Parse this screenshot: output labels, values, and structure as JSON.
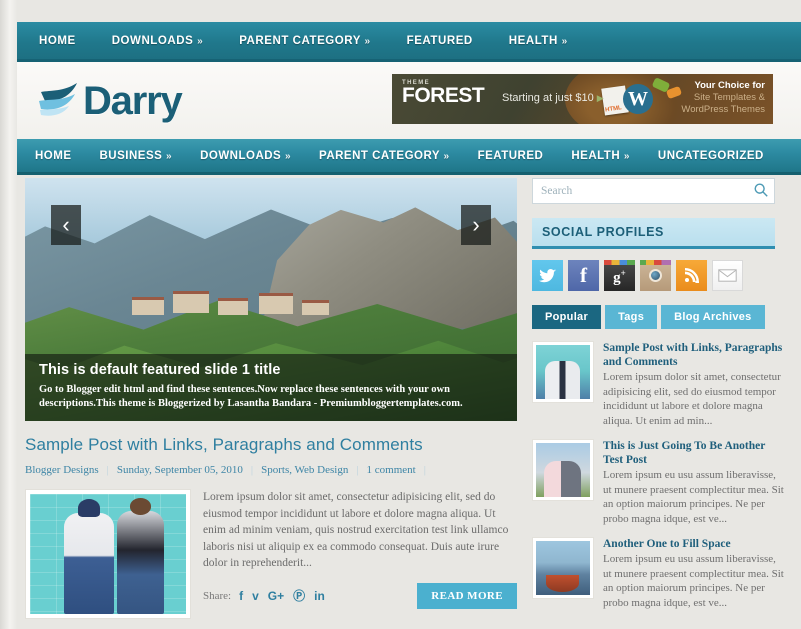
{
  "topnav": {
    "items": [
      {
        "label": "HOME",
        "caret": false
      },
      {
        "label": "DOWNLOADS",
        "caret": true
      },
      {
        "label": "PARENT CATEGORY",
        "caret": true
      },
      {
        "label": "FEATURED",
        "caret": false
      },
      {
        "label": "HEALTH",
        "caret": true
      }
    ]
  },
  "header": {
    "logo_text": "Darry",
    "logo_icon": "wing-swoosh-icon"
  },
  "ad": {
    "brand_small": "THEME",
    "brand_big": "FOREST",
    "price_text": "Starting at just $10",
    "arrow": "▶",
    "line1": "Your Choice for",
    "line2": "Site Templates &",
    "line3": "WordPress Themes",
    "wp_letter": "W",
    "doc_label": "HTML"
  },
  "mainnav": {
    "items": [
      {
        "label": "HOME",
        "caret": false
      },
      {
        "label": "BUSINESS",
        "caret": true
      },
      {
        "label": "DOWNLOADS",
        "caret": true
      },
      {
        "label": "PARENT CATEGORY",
        "caret": true
      },
      {
        "label": "FEATURED",
        "caret": false
      },
      {
        "label": "HEALTH",
        "caret": true
      },
      {
        "label": "UNCATEGORIZED",
        "caret": false
      }
    ]
  },
  "slider": {
    "prev_glyph": "‹",
    "next_glyph": "›",
    "title": "This is default featured slide 1 title",
    "description": "Go to Blogger edit html and find these sentences.Now replace these sentences with your own descriptions.This theme is Bloggerized by Lasantha Bandara - Premiumbloggertemplates.com."
  },
  "post": {
    "title": "Sample Post with Links, Paragraphs and Comments",
    "author": "Blogger Designs",
    "date": "Sunday, September 05, 2010",
    "categories": "Sports, Web Design",
    "comments": "1 comment",
    "excerpt": "Lorem ipsum dolor sit amet, consectetur adipisicing elit, sed do eiusmod tempor incididunt ut labore et dolore magna aliqua. Ut enim ad minim veniam, quis nostrud exercitation test link ullamco laboris nisi ut aliquip ex ea commodo consequat. Duis aute irure dolor in reprehenderit...",
    "share_label": "Share:",
    "share_icons": [
      {
        "name": "facebook-icon",
        "glyph": "f"
      },
      {
        "name": "twitter-icon",
        "glyph": "ᴠ"
      },
      {
        "name": "google-plus-icon",
        "glyph": "G+"
      },
      {
        "name": "pinterest-icon",
        "glyph": "Ⓟ"
      },
      {
        "name": "linkedin-icon",
        "glyph": "in"
      }
    ],
    "read_more": "READ MORE",
    "thumb_alt": "two-women-teal-brick-wall"
  },
  "sidebar": {
    "search": {
      "placeholder": "Search",
      "value": "",
      "icon": "search-icon"
    },
    "social_widget": {
      "title": "SOCIAL PROFILES",
      "icons": [
        {
          "name": "twitter-icon",
          "glyph": "ᴠ",
          "class": "s-tw"
        },
        {
          "name": "facebook-icon",
          "glyph": "f",
          "class": "s-fb"
        },
        {
          "name": "google-plus-icon",
          "glyph": "g+",
          "class": "s-gp"
        },
        {
          "name": "instagram-icon",
          "glyph": "",
          "class": "s-ig"
        },
        {
          "name": "rss-icon",
          "glyph": "≋",
          "class": "s-rss"
        },
        {
          "name": "email-icon",
          "glyph": "✉",
          "class": "s-ml"
        }
      ]
    },
    "tabs": [
      {
        "label": "Popular",
        "active": true
      },
      {
        "label": "Tags",
        "active": false
      },
      {
        "label": "Blog Archives",
        "active": false
      }
    ],
    "popular_posts": [
      {
        "title": "Sample Post with Links, Paragraphs and Comments",
        "excerpt": "Lorem ipsum dolor sit amet, consectetur adipisicing elit, sed do eiusmod tempor incididunt ut labore et dolore magna aliqua. Ut enim ad min...",
        "thumb_alt": "two-women-teal-wall"
      },
      {
        "title": "This is Just Going To Be Another Test Post",
        "excerpt": "Lorem ipsum eu usu assum liberavisse, ut munere praesent complectitur mea. Sit an option maiorum principes. Ne per probo magna idque, est ve...",
        "thumb_alt": "couple-outdoors"
      },
      {
        "title": "Another One to Fill Space",
        "excerpt": "Lorem ipsum eu usu assum liberavisse, ut munere praesent complectitur mea. Sit an option maiorum principes. Ne per probo magna idque, est ve...",
        "thumb_alt": "person-in-canoe"
      }
    ]
  },
  "colors": {
    "teal_dark": "#1d7082",
    "teal_mid": "#2d8ba2",
    "accent_blue": "#4bb0cf",
    "tab_active": "#1b6781",
    "link_blue": "#2f7fa0"
  }
}
